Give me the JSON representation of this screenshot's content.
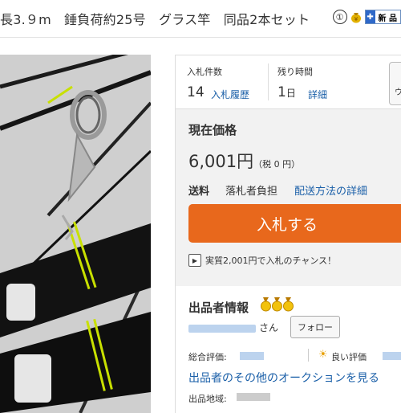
{
  "title": "長3.９m　錘負荷約25号　グラス竿　同品2本セット",
  "title_icons": {
    "circled": "①",
    "new_label": "新 品"
  },
  "stats": {
    "bids_label": "入札件数",
    "bids_count": "14",
    "bid_history_link": "入札履歴",
    "time_label": "残り時間",
    "time_value": "1",
    "time_unit": "日",
    "time_detail_link": "詳細",
    "watch_label": "ウ"
  },
  "price": {
    "label": "現在価格",
    "value": "6,001円",
    "tax": "（税 0 円）",
    "shipping_label": "送料",
    "shipping_value": "落札者負担",
    "shipping_link": "配送方法の詳細",
    "bid_button": "入札する",
    "chance_text": "実質2,001円で入札のチャンス！"
  },
  "seller": {
    "title": "出品者情報",
    "san": "さん",
    "follow_button": "フォロー",
    "total_rating_label": "総合評価:",
    "good_rating_label": "良い評価",
    "other_auctions_link": "出品者のその他のオークションを見る",
    "region_label": "出品地域:"
  },
  "colors": {
    "accent": "#e8681c",
    "link": "#1a5fa8",
    "band": "#c8e000"
  }
}
